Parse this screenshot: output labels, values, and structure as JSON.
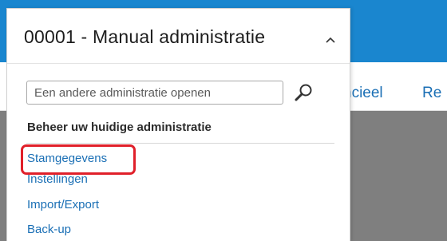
{
  "background_nav": {
    "financieel_partial": "ncieel",
    "next_partial": "Re"
  },
  "company_dropdown": {
    "title": "00001 - Manual administratie",
    "search_placeholder": "Een andere administratie openen",
    "section_heading": "Beheer uw huidige administratie",
    "links": [
      {
        "label": "Stamgegevens"
      },
      {
        "label": "Instellingen"
      },
      {
        "label": "Import/Export"
      },
      {
        "label": "Back-up"
      }
    ]
  },
  "icons": {
    "expand_state": "chevron-up-icon",
    "search": "search-icon"
  },
  "colors": {
    "topbar": "#1a86cf",
    "link": "#1a6fb5",
    "highlight": "#e0202a",
    "overlay": "#7f7f7f"
  }
}
